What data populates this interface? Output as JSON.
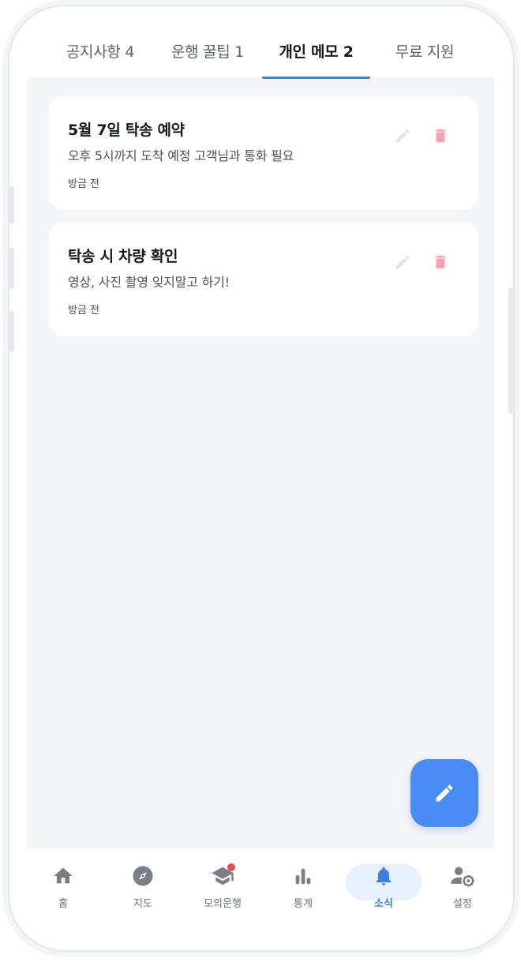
{
  "tabs": [
    {
      "label": "공지사항 4",
      "active": false
    },
    {
      "label": "운행 꿀팁 1",
      "active": false
    },
    {
      "label": "개인 메모 2",
      "active": true
    },
    {
      "label": "무료 지원",
      "active": false
    }
  ],
  "memos": [
    {
      "title": "5월 7일 탁송 예약",
      "body": "오후 5시까지 도착 예정 고객님과 통화 필요",
      "time": "방금 전"
    },
    {
      "title": "탁송 시 차량 확인",
      "body": "영상, 사진 촬영 잊지말고 하기!",
      "time": "방금 전"
    }
  ],
  "fab": {
    "icon": "pencil-icon"
  },
  "bottom_nav": [
    {
      "label": "홈",
      "icon": "home-icon",
      "active": false
    },
    {
      "label": "지도",
      "icon": "compass-icon",
      "active": false
    },
    {
      "label": "모의운행",
      "icon": "graduation-cap-icon",
      "active": false,
      "badge": true
    },
    {
      "label": "통계",
      "icon": "bar-chart-icon",
      "active": false
    },
    {
      "label": "소식",
      "icon": "bell-icon",
      "active": true
    },
    {
      "label": "설정",
      "icon": "user-settings-icon",
      "active": false
    }
  ],
  "colors": {
    "accent": "#3f7fe0",
    "fab": "#4a8af4",
    "delete": "#f2a4aa",
    "edit": "#e3e4e7",
    "badge": "#ea4a5a"
  }
}
